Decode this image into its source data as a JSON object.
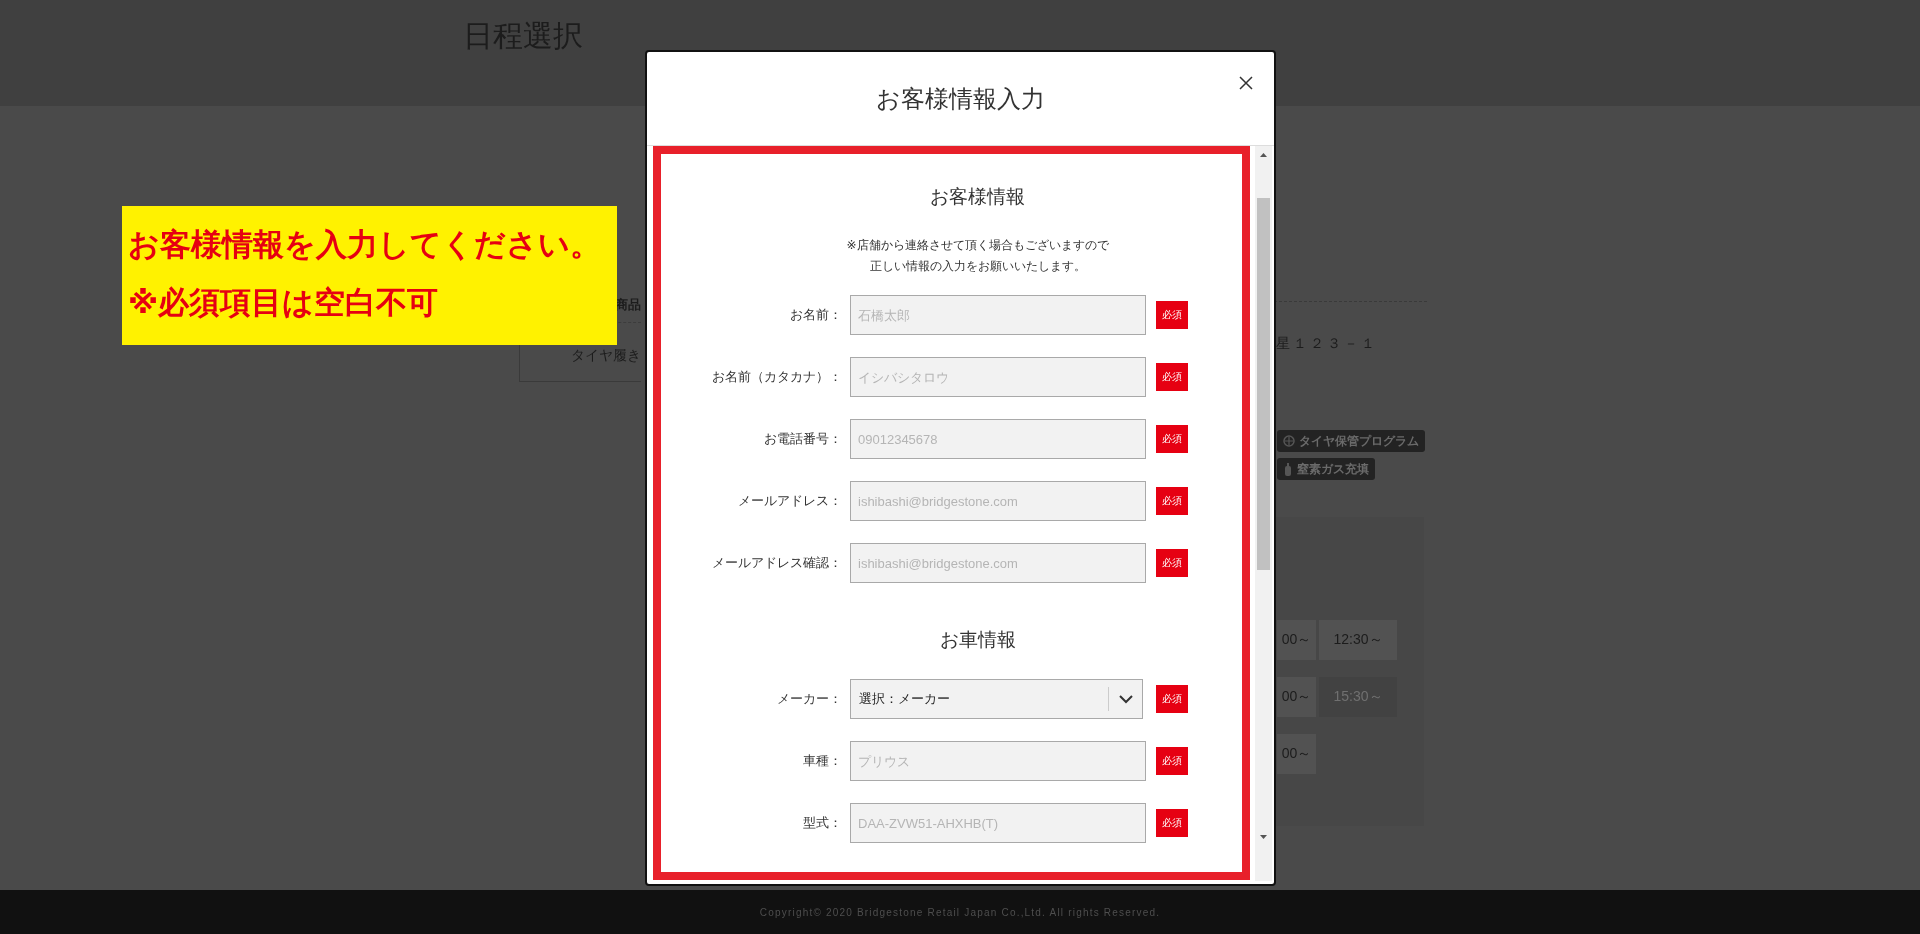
{
  "page": {
    "title": "日程選択",
    "card": {
      "heading": "商品",
      "item": "タイヤ履き"
    },
    "address": "星１２３－１",
    "service_badges": [
      {
        "label": "タイヤ保管プログラム",
        "kind": "storage"
      },
      {
        "label": "窒素ガス充填",
        "kind": "gas"
      }
    ],
    "time_slots": [
      {
        "label": "00～",
        "disabled": false
      },
      {
        "label": "12:30～",
        "disabled": false
      },
      {
        "label": "00～",
        "disabled": false
      },
      {
        "label": "15:30～",
        "disabled": true
      },
      {
        "label": "00～",
        "disabled": false
      }
    ]
  },
  "annotation": {
    "lines": [
      "お客様情報を入力してください。",
      "※必須項目は空白不可"
    ]
  },
  "modal": {
    "title": "お客様情報入力",
    "sections": [
      {
        "heading": "お客様情報",
        "note": [
          "※店舗から連絡させて頂く場合もございますので",
          "正しい情報の入力をお願いいたします。"
        ],
        "fields": [
          {
            "label": "お名前：",
            "kind": "text",
            "placeholder": "石橋太郎",
            "badge": "必須"
          },
          {
            "label": "お名前（カタカナ）：",
            "kind": "text",
            "placeholder": "イシバシタロウ",
            "badge": "必須"
          },
          {
            "label": "お電話番号：",
            "kind": "text",
            "placeholder": "09012345678",
            "badge": "必須"
          },
          {
            "label": "メールアドレス：",
            "kind": "text",
            "placeholder": "ishibashi@bridgestone.com",
            "badge": "必須"
          },
          {
            "label": "メールアドレス確認：",
            "kind": "text",
            "placeholder": "ishibashi@bridgestone.com",
            "badge": "必須"
          }
        ]
      },
      {
        "heading": "お車情報",
        "fields": [
          {
            "label": "メーカー：",
            "kind": "select",
            "value": "選択：メーカー",
            "badge": "必須"
          },
          {
            "label": "車種：",
            "kind": "text",
            "placeholder": "プリウス",
            "badge": "必須"
          },
          {
            "label": "型式：",
            "kind": "text",
            "placeholder": "DAA-ZVW51-AHXHB(T)",
            "badge": "必須"
          }
        ]
      }
    ]
  },
  "footer": {
    "copyright": "Copyright© 2020 Bridgestone Retail Japan Co.,Ltd. All rights Reserved."
  }
}
